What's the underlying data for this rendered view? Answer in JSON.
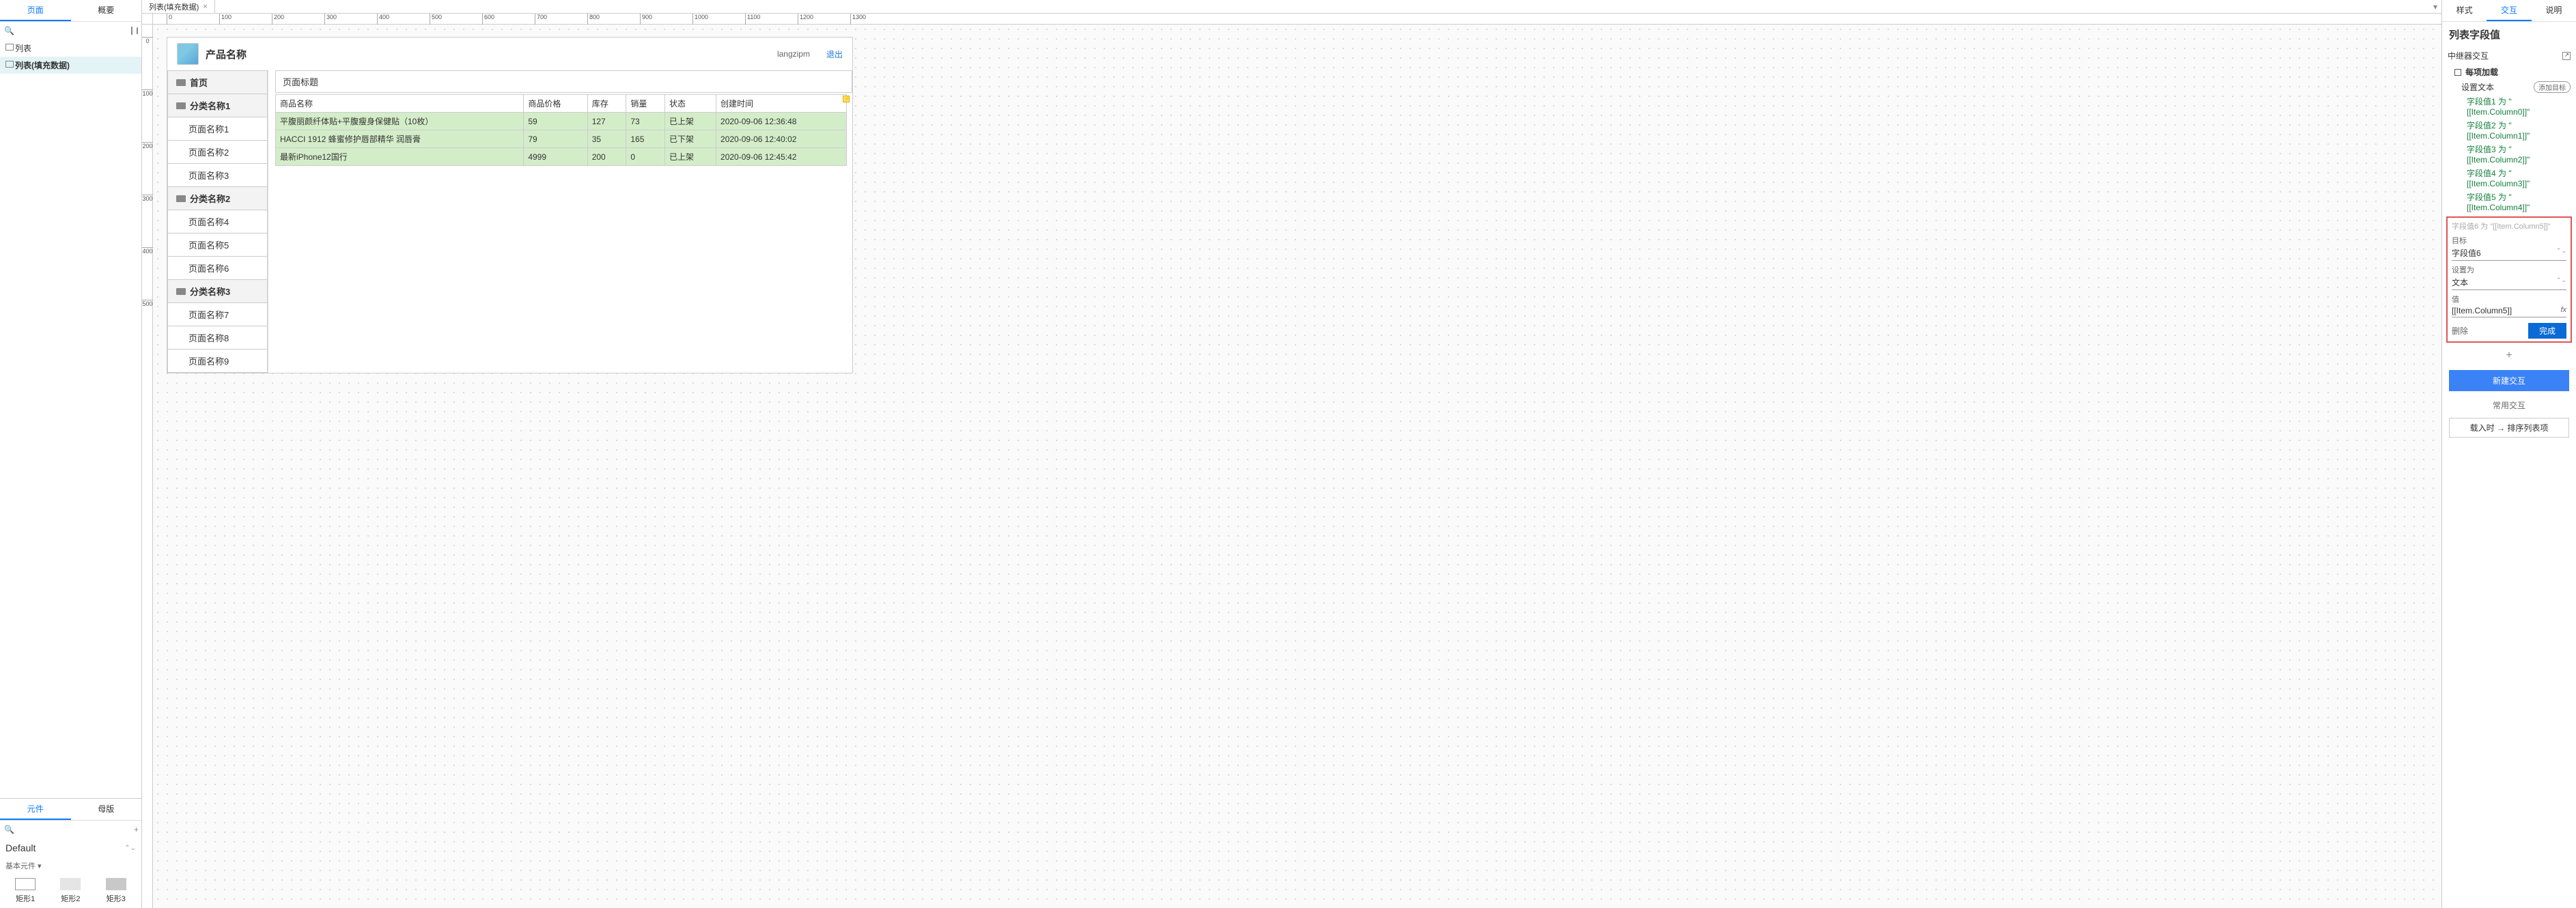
{
  "left": {
    "tabs": {
      "pages": "页面",
      "summary": "概要"
    },
    "search_placeholder": "",
    "tree": [
      {
        "label": "列表",
        "selected": false
      },
      {
        "label": "列表(填充数据)",
        "selected": true
      }
    ],
    "lower_tabs": {
      "widgets": "元件",
      "masters": "母版"
    },
    "default_lib": "Default",
    "basic_group": "基本元件 ▾",
    "shapes": [
      "矩形1",
      "矩形2",
      "矩形3"
    ]
  },
  "tab": {
    "title": "列表(填充数据)",
    "close": "×",
    "dropdown": "▾"
  },
  "ruler_h": [
    0,
    100,
    200,
    300,
    400,
    500,
    600,
    700,
    800,
    900,
    1000,
    1100,
    1200,
    1300
  ],
  "ruler_v": [
    0,
    100,
    200,
    300,
    400,
    500
  ],
  "page": {
    "product_title": "产品名称",
    "user": "langzipm",
    "logout": "退出",
    "side": [
      {
        "label": "首页",
        "cat": true
      },
      {
        "label": "分类名称1",
        "cat": true
      },
      {
        "label": "页面名称1",
        "cat": false
      },
      {
        "label": "页面名称2",
        "cat": false
      },
      {
        "label": "页面名称3",
        "cat": false
      },
      {
        "label": "分类名称2",
        "cat": true
      },
      {
        "label": "页面名称4",
        "cat": false
      },
      {
        "label": "页面名称5",
        "cat": false
      },
      {
        "label": "页面名称6",
        "cat": false
      },
      {
        "label": "分类名称3",
        "cat": true
      },
      {
        "label": "页面名称7",
        "cat": false
      },
      {
        "label": "页面名称8",
        "cat": false
      },
      {
        "label": "页面名称9",
        "cat": false
      }
    ],
    "main_title": "页面标题",
    "table": {
      "headers": [
        "商品名称",
        "商品价格",
        "库存",
        "销量",
        "状态",
        "创建时间"
      ],
      "rows": [
        [
          "平腹丽颜纤体贴+平腹瘦身保健贴（10枚）",
          "59",
          "127",
          "73",
          "已上架",
          "2020-09-06 12:36:48"
        ],
        [
          "HACCI 1912 蜂蜜修护唇部精华 润唇膏",
          "79",
          "35",
          "165",
          "已下架",
          "2020-09-06 12:40:02"
        ],
        [
          "最新iPhone12国行",
          "4999",
          "200",
          "0",
          "已上架",
          "2020-09-06 12:45:42"
        ]
      ]
    }
  },
  "right": {
    "tabs": {
      "style": "样式",
      "interact": "交互",
      "note": "说明"
    },
    "section_title": "列表字段值",
    "repeater_label": "中继器交互",
    "event": "每项加载",
    "action_label": "设置文本",
    "add_target": "添加目标",
    "lines": [
      "字段值1 为 \"[[Item.Column0]]\"",
      "字段值2 为 \"[[Item.Column1]]\"",
      "字段值3 为 \"[[Item.Column2]]\"",
      "字段值4 为 \"[[Item.Column3]]\"",
      "字段值5 为 \"[[Item.Column4]]\""
    ],
    "edit": {
      "hint": "字段值6 为 \"[[Item.Column5]]\"",
      "target_lbl": "目标",
      "target_val": "字段值6",
      "set_lbl": "设置为",
      "set_val": "文本",
      "val_lbl": "值",
      "val_val": "[[Item.Column5]]",
      "fx": "fx",
      "delete": "删除",
      "done": "完成"
    },
    "new_interact": "新建交互",
    "common": "常用交互",
    "quick": "载入时 → 排序列表项"
  }
}
